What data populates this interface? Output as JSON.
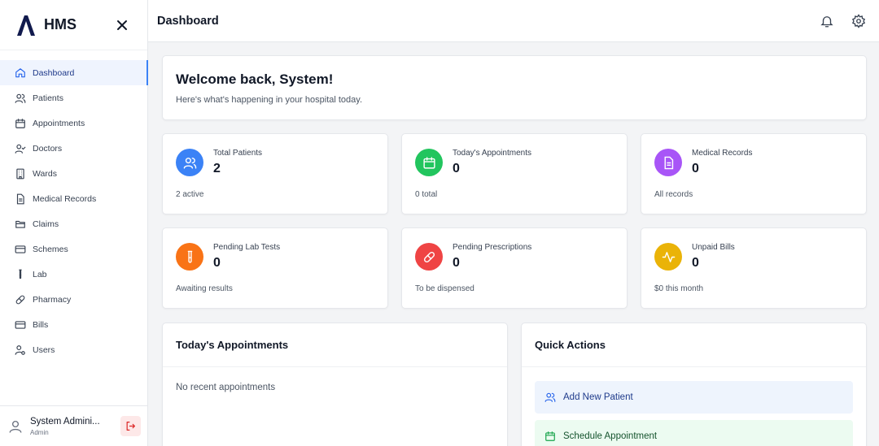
{
  "brand": {
    "name": "HMS"
  },
  "sidebar": {
    "items": [
      {
        "label": "Dashboard",
        "icon": "home-icon",
        "active": true
      },
      {
        "label": "Patients",
        "icon": "users-icon"
      },
      {
        "label": "Appointments",
        "icon": "calendar-icon"
      },
      {
        "label": "Doctors",
        "icon": "user-check-icon"
      },
      {
        "label": "Wards",
        "icon": "building-icon"
      },
      {
        "label": "Medical Records",
        "icon": "file-icon"
      },
      {
        "label": "Claims",
        "icon": "folder-icon"
      },
      {
        "label": "Schemes",
        "icon": "credit-card-icon"
      },
      {
        "label": "Lab",
        "icon": "test-tube-icon"
      },
      {
        "label": "Pharmacy",
        "icon": "pill-icon"
      },
      {
        "label": "Bills",
        "icon": "bill-card-icon"
      },
      {
        "label": "Users",
        "icon": "user-cog-icon"
      }
    ]
  },
  "user": {
    "name": "System Admini...",
    "role": "Admin"
  },
  "header": {
    "title": "Dashboard"
  },
  "welcome": {
    "title": "Welcome back, System!",
    "subtitle": "Here's what's happening in your hospital today."
  },
  "stats": [
    {
      "label": "Total Patients",
      "value": "2",
      "foot": "2 active",
      "color": "#3b82f6",
      "icon": "users-icon"
    },
    {
      "label": "Today's Appointments",
      "value": "0",
      "foot": "0 total",
      "color": "#22c55e",
      "icon": "calendar-icon"
    },
    {
      "label": "Medical Records",
      "value": "0",
      "foot": "All records",
      "color": "#a855f7",
      "icon": "file-icon"
    },
    {
      "label": "Pending Lab Tests",
      "value": "0",
      "foot": "Awaiting results",
      "color": "#f97316",
      "icon": "test-tube-icon"
    },
    {
      "label": "Pending Prescriptions",
      "value": "0",
      "foot": "To be dispensed",
      "color": "#ef4444",
      "icon": "pill-icon"
    },
    {
      "label": "Unpaid Bills",
      "value": "0",
      "foot": "$0 this month",
      "color": "#eab308",
      "icon": "activity-icon"
    }
  ],
  "appointments_panel": {
    "title": "Today's Appointments",
    "empty": "No recent appointments"
  },
  "quick_actions": {
    "title": "Quick Actions",
    "items": [
      {
        "label": "Add New Patient",
        "bg": "#eef4fd",
        "color": "#1e3a8a",
        "icon": "users-icon"
      },
      {
        "label": "Schedule Appointment",
        "bg": "#ecfbf1",
        "color": "#14532d",
        "icon": "calendar-icon"
      }
    ]
  },
  "colors": {
    "accent": "#3b82f6",
    "logout": "#dc2626"
  }
}
